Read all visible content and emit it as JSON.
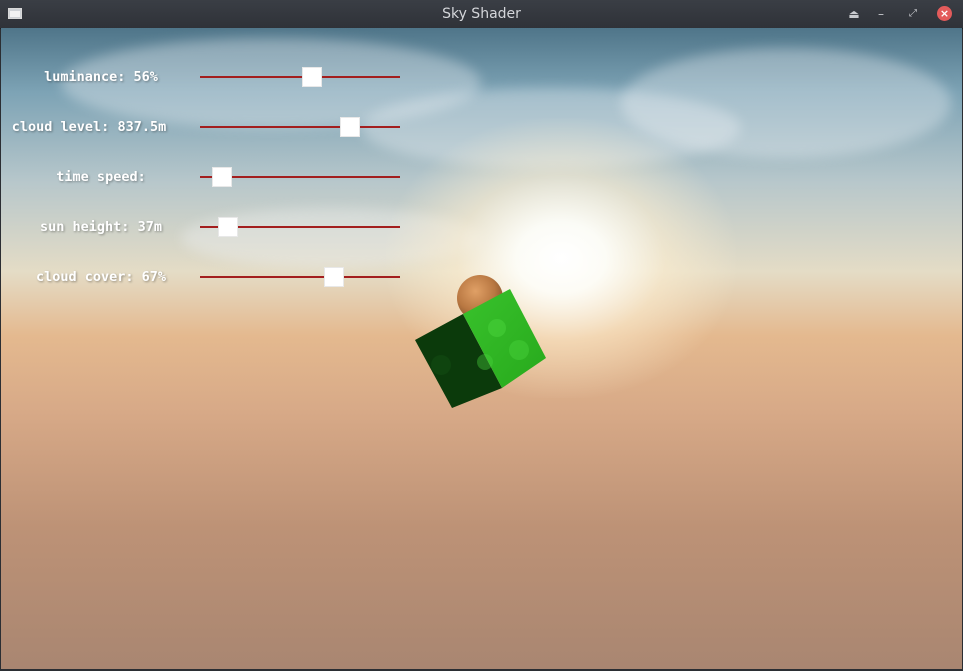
{
  "window": {
    "title": "Sky Shader"
  },
  "icons": {
    "app": "window-icon",
    "eject": "eject-icon",
    "minimize": "minimize-icon",
    "restore": "restore-icon",
    "close": "close-icon"
  },
  "colors": {
    "track": "#a31e1e",
    "thumb": "#ffffff",
    "close_button": "#e35b5b"
  },
  "controls": [
    {
      "label": "luminance: 56%",
      "value_fraction": 0.56
    },
    {
      "label": "cloud level: 837.5m",
      "value_fraction": 0.75
    },
    {
      "label": "time speed:",
      "value_fraction": 0.11
    },
    {
      "label": "sun height: 37m",
      "value_fraction": 0.14
    },
    {
      "label": "cloud cover: 67%",
      "value_fraction": 0.67
    }
  ]
}
